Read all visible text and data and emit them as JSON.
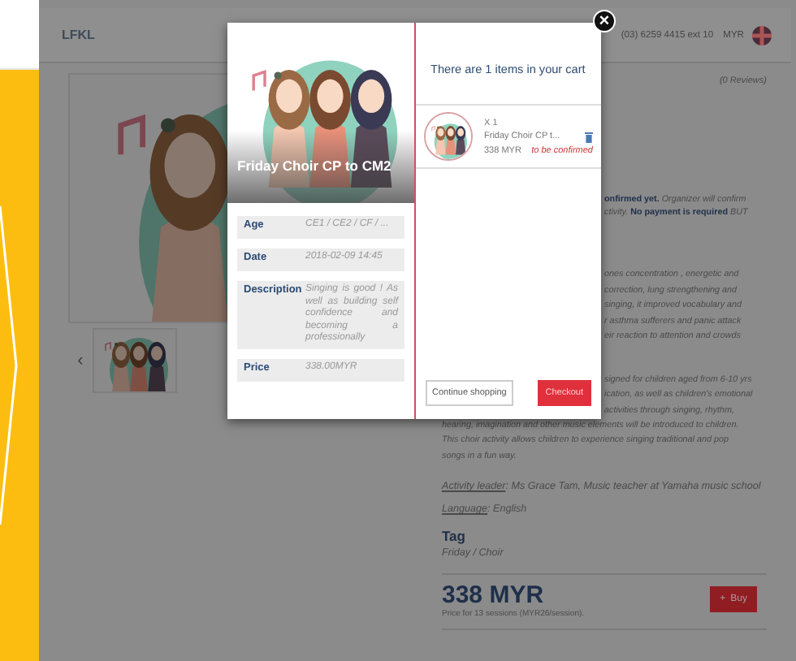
{
  "header": {
    "logo": "LFKL",
    "phone": "(03) 6259 4415 ext 10",
    "currency": "MYR"
  },
  "gallery": {
    "prev_arrow": "‹"
  },
  "details": {
    "reviews": "(0 Reviews)",
    "notice_lines": [
      "**onfirmed yet.** Organizer will confirm",
      "ctivity. **No payment is required** BUT"
    ],
    "paragraph_1_lines": [
      "ones concentration , energetic and",
      "correction, lung strengthening and",
      "singing, it improved vocabulary and",
      "r asthma sufferers and panic attack",
      "eir reaction to attention and crowds"
    ],
    "paragraph_2_cut_lines": [
      "signed for children aged from 6-10 yrs",
      "ication, as well as children's emotional",
      "activities through singing, rhythm,"
    ],
    "paragraph_2_lines": [
      "hearing, imagination and other music elements will be introduced to children.",
      "This choir activity allows children to experience singing traditional and pop",
      "songs in a fun way."
    ],
    "activity_leader": {
      "label": "Activity leader",
      "value": ": Ms Grace Tam, Music teacher at Yamaha music school"
    },
    "language": {
      "label": "Language",
      "value": ": English"
    },
    "tag_heading": "Tag",
    "tags": "Friday / Choir",
    "price": "338 MYR",
    "price_note": "Price for 13 sessions (MYR26/session).",
    "book_button": {
      "icon": "+",
      "label": "Buy"
    }
  },
  "modal": {
    "close": "×",
    "title": "Friday Choir CP to CM2",
    "info": [
      {
        "label": "Age",
        "value": "CE1 / CE2 / CF / ..."
      },
      {
        "label": "Date",
        "value": "2018-02-09 14:45"
      },
      {
        "label": "Description",
        "value": "Singing is good ! As well as building self confidence and becoming a professionally"
      },
      {
        "label": "Price",
        "value": "338.00MYR"
      }
    ],
    "cart_title": "There are 1 items in your cart",
    "cart_items": [
      {
        "quantity": "X 1",
        "name": "Friday Choir CP t...",
        "price": "338 MYR",
        "status": "to be confirmed"
      }
    ],
    "continue_button": "Continue shopping",
    "checkout_button": "Checkout"
  }
}
